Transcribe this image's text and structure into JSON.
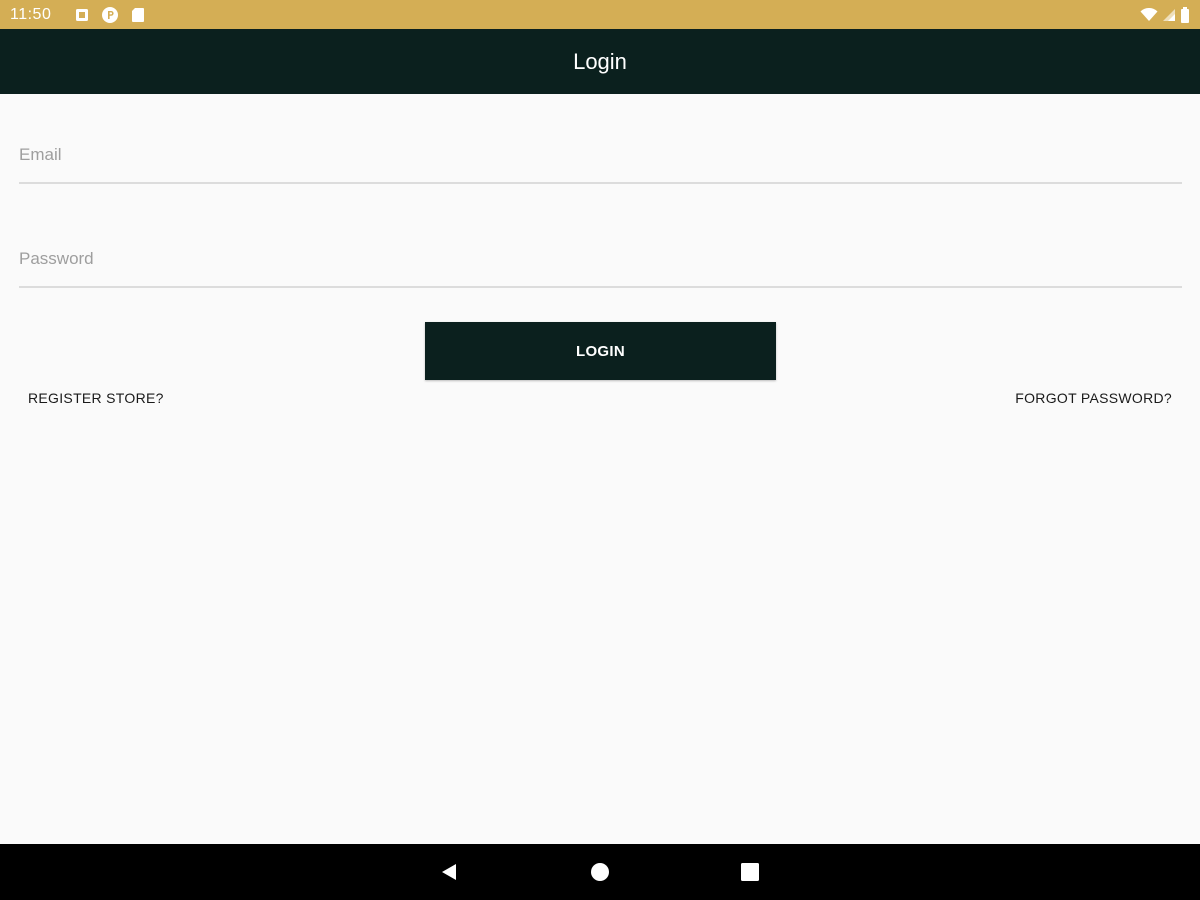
{
  "status_bar": {
    "time": "11:50",
    "left_icons": [
      "image-icon",
      "circle-p-icon",
      "sd-card-icon"
    ],
    "right_icons": [
      "wifi-icon",
      "signal-icon",
      "battery-icon"
    ],
    "background": "#d4ae55"
  },
  "app_bar": {
    "title": "Login",
    "background": "#0b201e"
  },
  "form": {
    "email": {
      "placeholder": "Email",
      "value": ""
    },
    "password": {
      "placeholder": "Password",
      "value": ""
    },
    "login_label": "LOGIN",
    "register_label": "REGISTER STORE?",
    "forgot_label": "FORGOT PASSWORD?"
  },
  "nav_bar": {
    "buttons": [
      "back-icon",
      "home-icon",
      "recents-icon"
    ]
  }
}
